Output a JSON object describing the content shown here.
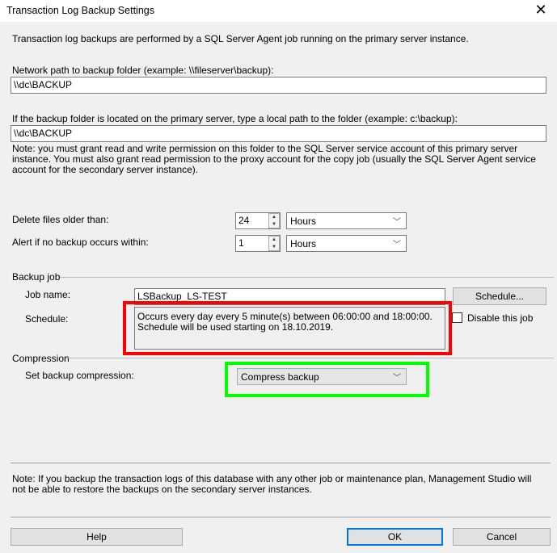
{
  "window": {
    "title": "Transaction Log Backup Settings",
    "close_icon": "close-icon"
  },
  "intro": "Transaction log backups are performed by a SQL Server Agent job running on the primary server instance.",
  "network_path": {
    "label": "Network path to backup folder (example: \\\\fileserver\\backup):",
    "value": "\\\\dc\\BACKUP"
  },
  "local_path": {
    "label": "If the backup folder is located on the primary server, type a local path to the folder (example: c:\\backup):",
    "value": "\\\\dc\\BACKUP"
  },
  "permission_note": "Note: you must grant read and write permission on this folder to the SQL Server service account of this primary server instance.  You must also grant read permission to the proxy account for the copy job (usually the SQL Server Agent service account for the secondary server instance).",
  "delete_files": {
    "label": "Delete files older than:",
    "value": "24",
    "unit": "Hours"
  },
  "alert": {
    "label": "Alert if no backup occurs within:",
    "value": "1",
    "unit": "Hours"
  },
  "backup_job": {
    "section": "Backup job",
    "job_name_label": "Job name:",
    "job_name": "LSBackup_LS-TEST",
    "schedule_button": "Schedule...",
    "schedule_label": "Schedule:",
    "schedule_text": "Occurs every day every 5 minute(s) between 06:00:00 and 18:00:00. Schedule will be used starting on 18.10.2019.",
    "disable_label": "Disable this job",
    "disable_checked": false
  },
  "compression": {
    "section": "Compression",
    "label": "Set backup compression:",
    "value": "Compress backup"
  },
  "footer_note": "Note: If you backup the transaction logs of this database with any other job or maintenance plan, Management Studio will not be able to restore the backups on the secondary server instances.",
  "buttons": {
    "help": "Help",
    "ok": "OK",
    "cancel": "Cancel"
  },
  "highlights": {
    "schedule_color": "#ff0000",
    "compression_color": "#00ff00"
  }
}
